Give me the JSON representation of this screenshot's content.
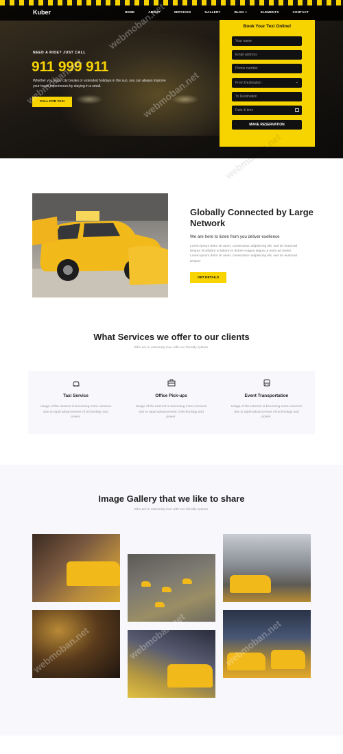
{
  "nav": {
    "brand": "Kuber",
    "items": [
      "HOME",
      "ABOUT",
      "SERVICES",
      "GALLERY",
      "BLOG",
      "ELEMENTS",
      "CONTACT"
    ]
  },
  "hero": {
    "kicker": "NEED A RIDE? JUST CALL",
    "phone": "911 999 911",
    "text": "Whether you enjoy city breaks or extended holidays in the sun, you can always improve your travel experiences by staying in a small.",
    "cta": "CALL FOR TAXI"
  },
  "booking": {
    "title": "Book Your Texi Online!",
    "name_placeholder": "Your name",
    "email_placeholder": "Email address",
    "phone_placeholder": "Phone number",
    "from_placeholder": "From Destination",
    "to_placeholder": "To Destination",
    "date_placeholder": "Date & time",
    "submit": "MAKE RESERVATION"
  },
  "about": {
    "title": "Globally Connected by Large Network",
    "subtitle": "We are here to listen from you deliver exellence",
    "body": "Lorem ipsum dolor sit amet, consectetur adipisicing elit, sed do eiusmod tempor incididunt ut labore et dolore magna aliqua ut enim ad minim. Lorem ipsum dolor sit amet, consectetur adipisicing elit, sed do eiusmod tempor",
    "cta": "GET DETAILS"
  },
  "services": {
    "title": "What Services we offer to our clients",
    "subtitle": "Who are in extremely love with eco friendly system.",
    "items": [
      {
        "icon": "taxi-icon",
        "name": "Taxi Service",
        "desc": "Usage of the Internet is becoming more common due to rapid advancement of technology and power."
      },
      {
        "icon": "briefcase-icon",
        "name": "Office Pick-ups",
        "desc": "Usage of the Internet is becoming more common due to rapid advancement of technology and power."
      },
      {
        "icon": "bus-icon",
        "name": "Event Transportation",
        "desc": "Usage of the Internet is becoming more common due to rapid advancement of technology and power."
      }
    ]
  },
  "gallery": {
    "title": "Image Gallery that we like to share",
    "subtitle": "Who are in extremely love with eco friendly system."
  },
  "watermark": "webmoban.net",
  "colors": {
    "accent": "#f7d300",
    "dark": "#111111"
  }
}
